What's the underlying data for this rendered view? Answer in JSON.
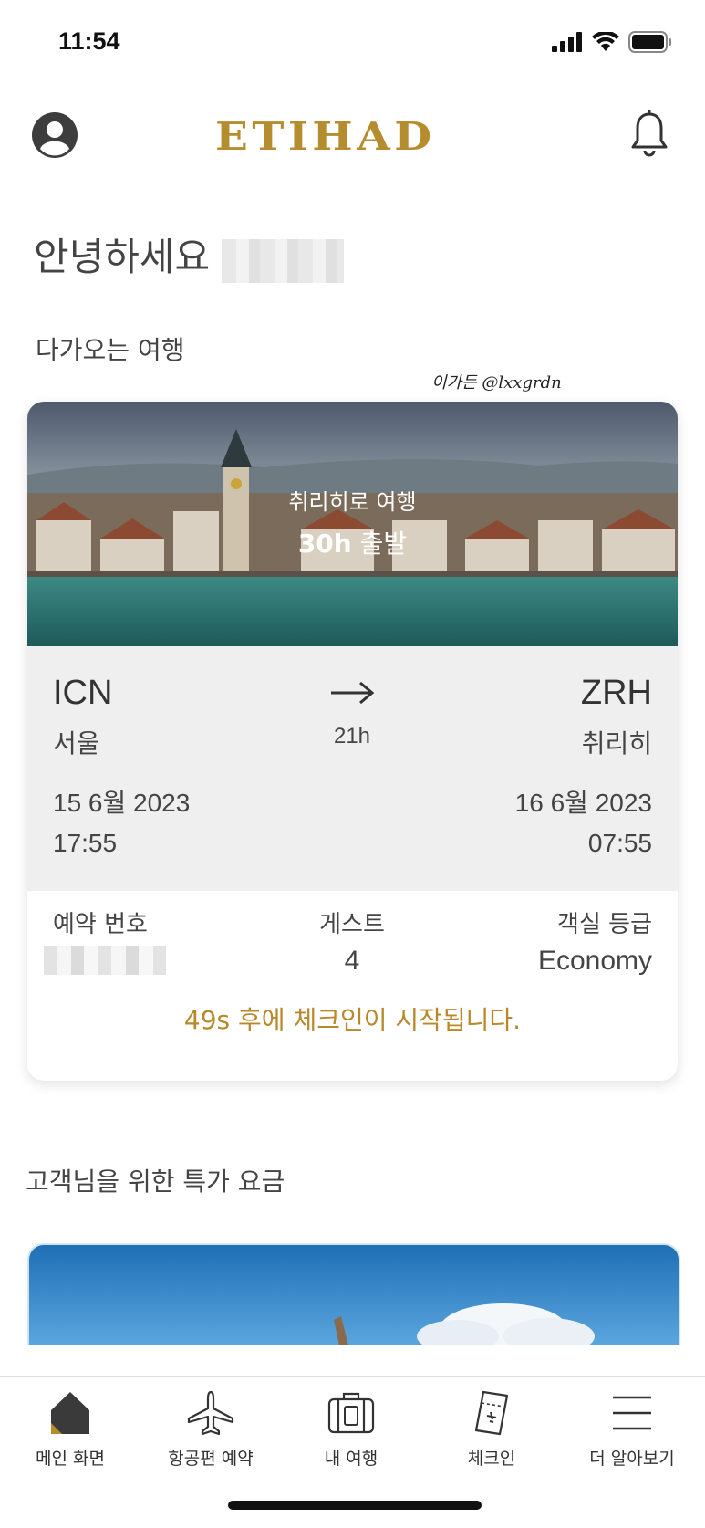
{
  "status_bar": {
    "time": "11:54"
  },
  "header": {
    "logo": "ETIHAD"
  },
  "greeting": "안녕하세요",
  "upcoming": {
    "section_title": "다가오는 여행",
    "watermark": "이가든 @lxxgrdn",
    "trip": {
      "hero_title": "취리히로 여행",
      "hero_countdown_value": "30h",
      "hero_countdown_suffix": "출발",
      "origin_code": "ICN",
      "origin_city": "서울",
      "destination_code": "ZRH",
      "destination_city": "취리히",
      "duration": "21h",
      "depart_date": "15 6월 2023",
      "depart_time": "17:55",
      "arrive_date": "16 6월 2023",
      "arrive_time": "07:55",
      "booking_label": "예약 번호",
      "guests_label": "게스트",
      "guests_value": "4",
      "cabin_label": "객실 등급",
      "cabin_value": "Economy",
      "checkin_note": "49s 후에 체크인이 시작됩니다."
    }
  },
  "offers": {
    "section_title": "고객님을 위한 특가 요금"
  },
  "bottom_nav": [
    {
      "label": "메인 화면",
      "icon": "home-icon",
      "active": true
    },
    {
      "label": "항공편 예약",
      "icon": "airplane-icon"
    },
    {
      "label": "내 여행",
      "icon": "suitcase-icon"
    },
    {
      "label": "체크인",
      "icon": "boarding-pass-icon"
    },
    {
      "label": "더 알아보기",
      "icon": "menu-icon"
    }
  ],
  "colors": {
    "accent_gold": "#b58d2e",
    "route_bg": "#efefef"
  }
}
